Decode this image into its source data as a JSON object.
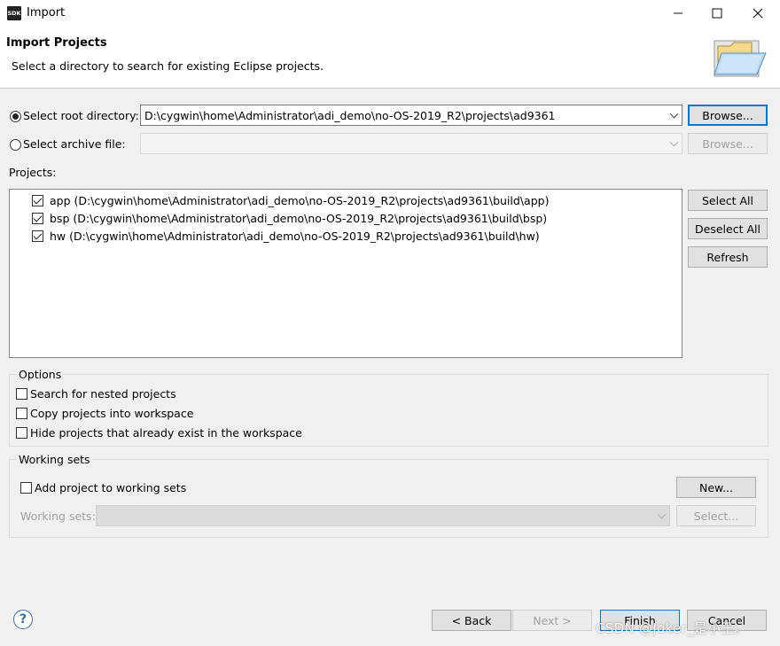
{
  "window": {
    "app_icon_text": "SDK",
    "title": "Import"
  },
  "banner": {
    "title": "Import Projects",
    "subtitle": "Select a directory to search for existing Eclipse projects."
  },
  "source": {
    "root_label": "Select root directory:",
    "root_value": "D:\\cygwin\\home\\Administrator\\adi_demo\\no-OS-2019_R2\\projects\\ad9361",
    "archive_label": "Select archive file:",
    "archive_value": "",
    "browse_label": "Browse..."
  },
  "projects": {
    "label": "Projects:",
    "items": [
      {
        "label": "app (D:\\cygwin\\home\\Administrator\\adi_demo\\no-OS-2019_R2\\projects\\ad9361\\build\\app)",
        "checked": true
      },
      {
        "label": "bsp (D:\\cygwin\\home\\Administrator\\adi_demo\\no-OS-2019_R2\\projects\\ad9361\\build\\bsp)",
        "checked": true
      },
      {
        "label": "hw (D:\\cygwin\\home\\Administrator\\adi_demo\\no-OS-2019_R2\\projects\\ad9361\\build\\hw)",
        "checked": true
      }
    ],
    "select_all": "Select All",
    "deselect_all": "Deselect All",
    "refresh": "Refresh"
  },
  "options": {
    "title": "Options",
    "nested": "Search for nested projects",
    "copy": "Copy projects into workspace",
    "hide": "Hide projects that already exist in the workspace"
  },
  "working_sets": {
    "title": "Working sets",
    "add_label": "Add project to working sets",
    "new_button": "New...",
    "sets_label": "Working sets:",
    "select_button": "Select..."
  },
  "footer": {
    "help": "?",
    "back": "< Back",
    "next": "Next >",
    "finish": "Finish",
    "cancel": "Cancel"
  },
  "watermark": "CSDN @Joker_是小王。"
}
